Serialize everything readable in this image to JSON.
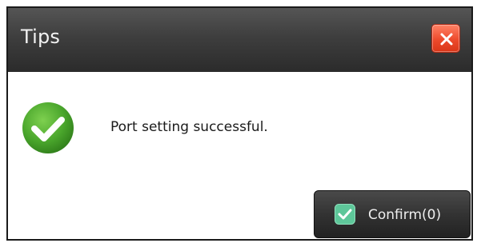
{
  "dialog": {
    "title": "Tips",
    "message": "Port setting successful.",
    "confirm_label": "Confirm(0)",
    "close_icon": "close-icon",
    "status_icon": "success-check-icon"
  },
  "colors": {
    "titlebar": "#3e3e3e",
    "close_button": "#ed4a2c",
    "success_green": "#4aa62c",
    "confirm_check": "#5ec79a"
  }
}
